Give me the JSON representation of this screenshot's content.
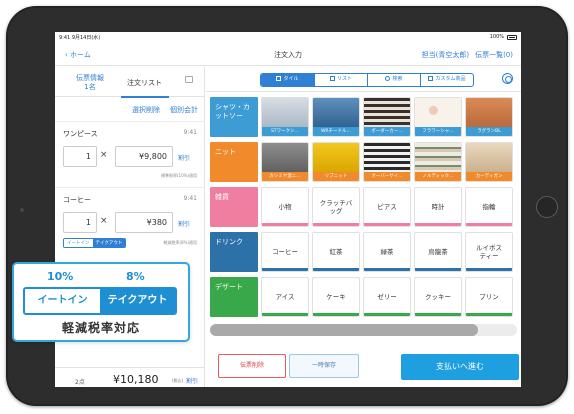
{
  "status_bar": {
    "time_date": "9:41  9月14日(水)",
    "battery": "100%"
  },
  "nav": {
    "back_label": "ホーム",
    "title": "注文入力",
    "staff": "担当(青空太郎)",
    "slip_list": "伝票一覧(0)"
  },
  "left": {
    "tab_slip_info_line1": "伝票情報",
    "tab_slip_info_line2": "1名",
    "tab_order_list": "注文リスト",
    "action_select_delete": "選択削除",
    "action_individual": "個別会計",
    "items": [
      {
        "name": "ワンピース",
        "time": "9:41",
        "qty": "1",
        "times": "×",
        "price": "¥9,800",
        "discount": "割引",
        "tax_note": "標準税率(10%)適用"
      },
      {
        "name": "コーヒー",
        "time": "9:41",
        "qty": "1",
        "times": "×",
        "price": "¥380",
        "discount": "割引",
        "tax_note": "軽減税率(8%)適用",
        "eat_in": "イートイン",
        "takeout": "テイクアウト"
      }
    ],
    "total": {
      "count": "2点",
      "amount": "¥10,180",
      "tax": "(税込)",
      "discount": "割引"
    }
  },
  "callout": {
    "rate_eat_in": "10%",
    "rate_takeout": "8%",
    "eat_in": "イートイン",
    "takeout": "テイクアウト",
    "caption": "軽減税率対応"
  },
  "right": {
    "segments": [
      "タイル",
      "リスト",
      "検索",
      "カスタム商品"
    ],
    "categories": [
      {
        "label": "シャツ・カットソー",
        "color": "#3d9cd4"
      },
      {
        "label": "ニット",
        "color": "#f08a2a"
      },
      {
        "label": "雑貨",
        "color": "#f07ea0"
      },
      {
        "label": "ドリンク",
        "color": "#2c72a8"
      },
      {
        "label": "デザート",
        "color": "#39a84a"
      }
    ],
    "row_shirts": [
      "STワークシ…",
      "WRチードル…",
      "ボーダーカー…",
      "フラワーシャ…",
      "ラグランBL"
    ],
    "row_knit": [
      "カシミヤ混ニ…",
      "リブニット",
      "オーバーサイ…",
      "ノルディック…",
      "カーディガン"
    ],
    "row_goods": [
      "小物",
      "クラッチバッグ",
      "ピアス",
      "時計",
      "指輪"
    ],
    "row_drinks": [
      "コーヒー",
      "紅茶",
      "緑茶",
      "烏龍茶",
      "ルイボスティー"
    ],
    "row_desserts": [
      "アイス",
      "ケーキ",
      "ゼリー",
      "クッキー",
      "プリン"
    ],
    "btn_cancel_slip": "伝票削除",
    "btn_hold": "一時保存",
    "btn_pay": "支払いへ進む"
  },
  "colors": {
    "accent": "#2f7fd4",
    "pay": "#1e9fe0",
    "danger": "#e24444"
  }
}
